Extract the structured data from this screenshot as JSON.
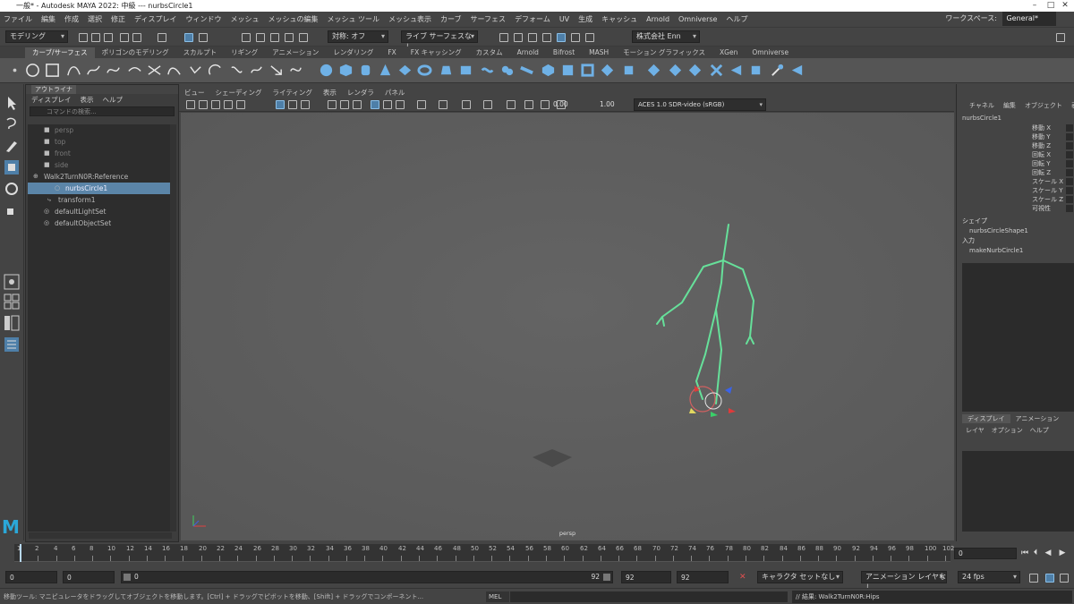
{
  "window": {
    "title": "一般* - Autodesk MAYA 2022: 中級 --- nurbsCircle1",
    "minimize_icon": "minimize-icon",
    "maximize_icon": "maximize-icon",
    "close_icon": "close-icon"
  },
  "menubar": {
    "items": [
      "ファイル",
      "編集",
      "作成",
      "選択",
      "修正",
      "ディスプレイ",
      "ウィンドウ",
      "メッシュ",
      "メッシュの編集",
      "メッシュ ツール",
      "メッシュ表示",
      "カーブ",
      "サーフェス",
      "デフォーム",
      "UV",
      "生成",
      "キャッシュ",
      "Arnold",
      "Omniverse",
      "ヘルプ"
    ],
    "workspace_label": "ワークスペース:",
    "workspace_value": "General*"
  },
  "statusline": {
    "mode": "モデリング",
    "symmetry": "対称: オフ",
    "no_live": "ライブ サーフェスなし",
    "renderer": "株式会社 Enn"
  },
  "shelf": {
    "tabs": [
      "カーブ/サーフェス",
      "ポリゴンのモデリング",
      "スカルプト",
      "リギング",
      "アニメーション",
      "レンダリング",
      "FX",
      "FX キャッシング",
      "カスタム",
      "Arnold",
      "Bifrost",
      "MASH",
      "モーション グラフィックス",
      "XGen",
      "Omniverse"
    ],
    "active_tab": 0
  },
  "outliner": {
    "title": "アウトライナ",
    "menu": [
      "ディスプレイ",
      "表示",
      "ヘルプ"
    ],
    "search_placeholder": "コマンドの検索...",
    "rows": [
      {
        "label": "persp",
        "icon": "camera-icon",
        "state": "dim"
      },
      {
        "label": "top",
        "icon": "camera-icon",
        "state": "dim"
      },
      {
        "label": "front",
        "icon": "camera-icon",
        "state": "dim"
      },
      {
        "label": "side",
        "icon": "camera-icon",
        "state": "dim"
      },
      {
        "label": "Walk2TurnN0R:Reference",
        "icon": "reference-icon",
        "state": "normal"
      },
      {
        "label": "nurbsCircle1",
        "icon": "curve-icon",
        "state": "selected"
      },
      {
        "label": "transform1",
        "icon": "transform-icon",
        "state": "normal"
      },
      {
        "label": "defaultLightSet",
        "icon": "set-icon",
        "state": "normal"
      },
      {
        "label": "defaultObjectSet",
        "icon": "set-icon",
        "state": "normal"
      }
    ]
  },
  "viewport": {
    "menu": [
      "ビュー",
      "シェーディング",
      "ライティング",
      "表示",
      "レンダラ",
      "パネル"
    ],
    "exposure": "0.00",
    "gamma": "1.00",
    "color_space": "ACES 1.0 SDR-video (sRGB)",
    "camera_label": "persp",
    "axis_icon": "axis-gizmo-icon"
  },
  "channelbox": {
    "menu": [
      "チャネル",
      "編集",
      "オブジェクト",
      "表示"
    ],
    "object": "nurbsCircle1",
    "attrs": [
      "移動 X",
      "移動 Y",
      "移動 Z",
      "回転 X",
      "回転 Y",
      "回転 Z",
      "スケール X",
      "スケール Y",
      "スケール Z",
      "可視性"
    ],
    "shapes_label": "シェイプ",
    "shape_name": "nurbsCircleShape1",
    "inputs_label": "入力",
    "input_name": "makeNurbCircle1"
  },
  "layereditor": {
    "tabs": [
      "ディスプレイ",
      "アニメーション"
    ],
    "menu": [
      "レイヤ",
      "オプション",
      "ヘルプ"
    ]
  },
  "timeline": {
    "ticks": [
      "1",
      "2",
      "4",
      "6",
      "8",
      "10",
      "12",
      "14",
      "16",
      "18",
      "20",
      "22",
      "24",
      "26",
      "28",
      "30",
      "32",
      "34",
      "36",
      "38",
      "40",
      "42",
      "44",
      "46",
      "48",
      "50",
      "52",
      "54",
      "56",
      "58",
      "60",
      "62",
      "64",
      "66",
      "68",
      "70",
      "72",
      "74",
      "76",
      "78",
      "80",
      "82",
      "84",
      "86",
      "88",
      "90",
      "92",
      "94",
      "96",
      "98",
      "100",
      "102"
    ],
    "current_frame": "0"
  },
  "range": {
    "start": "0",
    "inner_start": "0",
    "range_start": "0",
    "range_end": "92",
    "end": "92",
    "end2": "92",
    "char_set": "キャラクタ セットなし",
    "anim_layer": "アニメーション レイヤなし",
    "fps": "24 fps"
  },
  "cmdline": {
    "help": "移動ツール: マニピュレータをドラッグしてオブジェクトを移動します。[Ctrl] + ドラッグでピボットを移動、[Shift] + ドラッグでコンポーネント...",
    "mel": "MEL",
    "result": "// 結果: Walk2TurnN0R:Hips"
  }
}
